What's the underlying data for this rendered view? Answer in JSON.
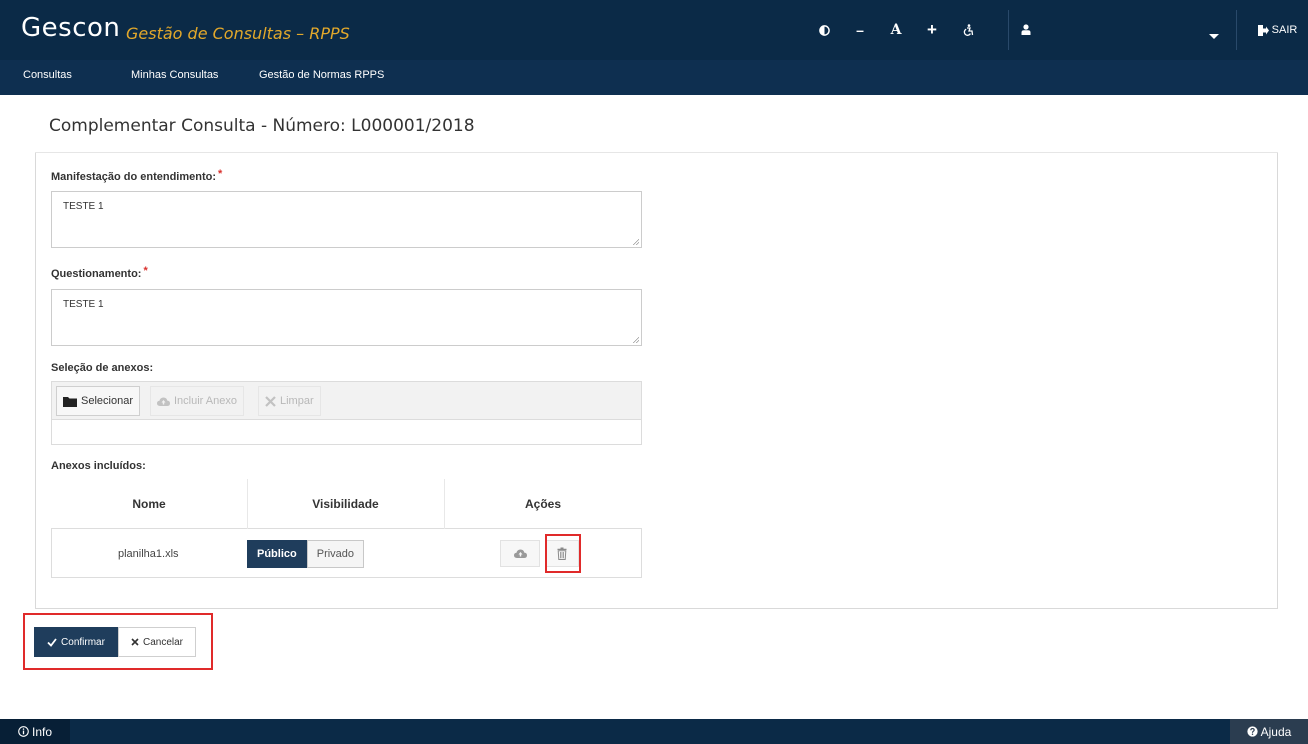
{
  "header": {
    "app_name": "Gescon",
    "tagline": "Gestão de Consultas – RPPS",
    "font_decrease": "–",
    "font_normal": "A",
    "font_increase": "+",
    "logout_label": "SAIR"
  },
  "nav": {
    "items": [
      {
        "label": "Consultas"
      },
      {
        "label": "Minhas Consultas"
      },
      {
        "label": "Gestão de Normas RPPS"
      }
    ]
  },
  "page": {
    "title": "Complementar Consulta - Número: L000001/2018"
  },
  "form": {
    "required_mark": "*",
    "manifestacao": {
      "label": "Manifestação do entendimento:",
      "value": "TESTE 1"
    },
    "questionamento": {
      "label": "Questionamento:",
      "value": "TESTE 1"
    },
    "anexos_selection": {
      "label": "Seleção de anexos:",
      "select_label": "Selecionar",
      "upload_label": "Incluir Anexo",
      "clear_label": "Limpar"
    },
    "anexos_table": {
      "label": "Anexos incluídos:",
      "columns": [
        "Nome",
        "Visibilidade",
        "Ações"
      ],
      "rows": [
        {
          "name": "planilha1.xls",
          "public_label": "Público",
          "private_label": "Privado",
          "visibility": "Público"
        }
      ]
    }
  },
  "actions": {
    "confirm_label": "Confirmar",
    "cancel_label": "Cancelar"
  },
  "footer": {
    "info_label": "Info",
    "help_label": "Ajuda"
  },
  "colors": {
    "header_bg": "#0b2a47",
    "nav_bg": "#0e2f50",
    "tagline": "#e2a82b",
    "primary": "#1f3d5c",
    "required": "#d9302c",
    "highlight": "#e02a2a"
  },
  "icons": [
    "contrast-icon",
    "accessibility-icon",
    "user-icon",
    "chevron-down-icon",
    "logout-icon",
    "folder-icon",
    "cloud-upload-icon",
    "close-icon",
    "trash-icon",
    "check-icon",
    "info-icon",
    "help-icon"
  ]
}
